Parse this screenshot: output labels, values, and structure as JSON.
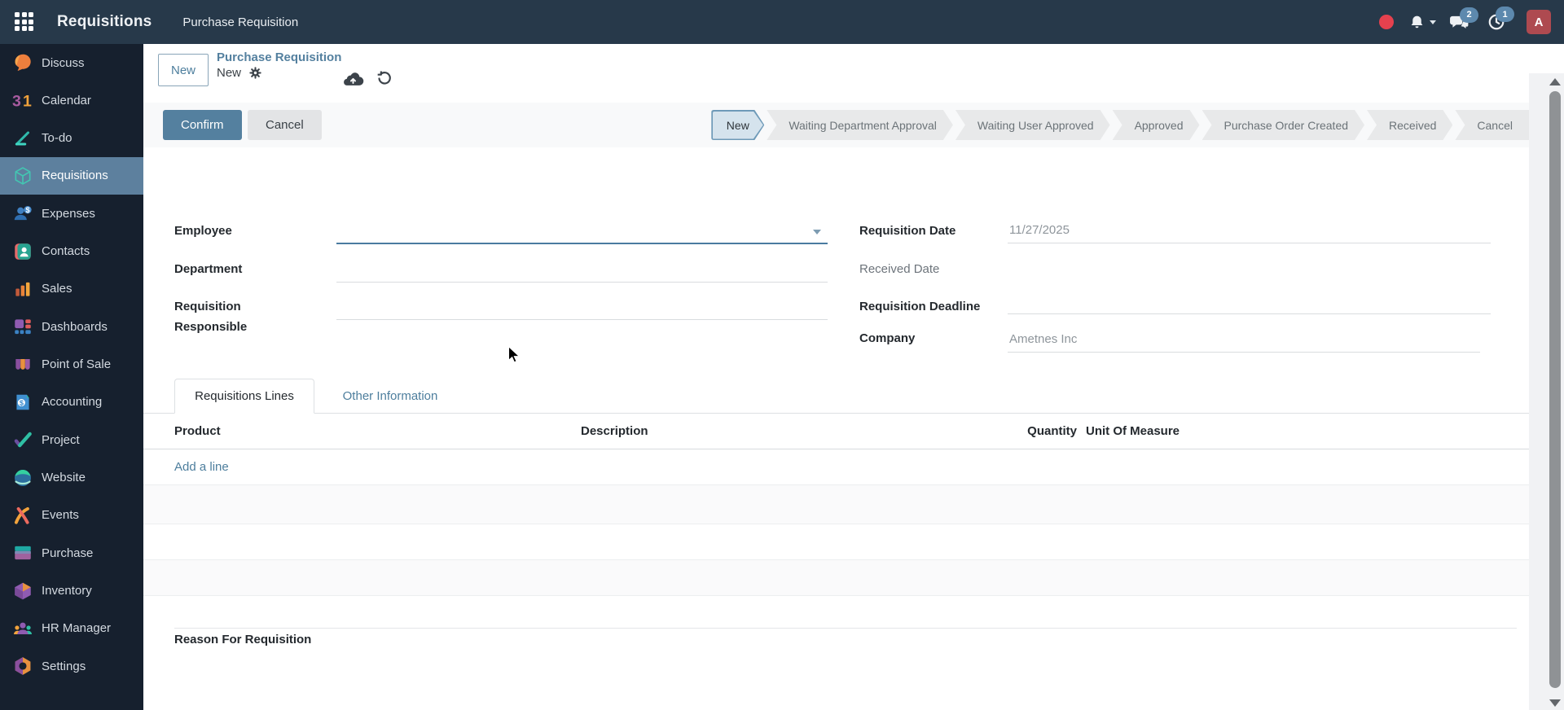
{
  "topbar": {
    "app_name": "Requisitions",
    "menu_item": "Purchase Requisition",
    "messages_badge": "2",
    "activities_badge": "1",
    "avatar_letter": "A"
  },
  "sidebar": {
    "items": [
      {
        "label": "Discuss",
        "icon": "discuss-icon",
        "active": false
      },
      {
        "label": "Calendar",
        "icon": "calendar-icon",
        "active": false
      },
      {
        "label": "To-do",
        "icon": "todo-icon",
        "active": false
      },
      {
        "label": "Requisitions",
        "icon": "requisitions-icon",
        "active": true
      },
      {
        "label": "Expenses",
        "icon": "expenses-icon",
        "active": false
      },
      {
        "label": "Contacts",
        "icon": "contacts-icon",
        "active": false
      },
      {
        "label": "Sales",
        "icon": "sales-icon",
        "active": false
      },
      {
        "label": "Dashboards",
        "icon": "dashboards-icon",
        "active": false
      },
      {
        "label": "Point of Sale",
        "icon": "point-of-sale-icon",
        "active": false
      },
      {
        "label": "Accounting",
        "icon": "accounting-icon",
        "active": false
      },
      {
        "label": "Project",
        "icon": "project-icon",
        "active": false
      },
      {
        "label": "Website",
        "icon": "website-icon",
        "active": false
      },
      {
        "label": "Events",
        "icon": "events-icon",
        "active": false
      },
      {
        "label": "Purchase",
        "icon": "purchase-icon",
        "active": false
      },
      {
        "label": "Inventory",
        "icon": "inventory-icon",
        "active": false
      },
      {
        "label": "HR Manager",
        "icon": "hr-manager-icon",
        "active": false
      },
      {
        "label": "Settings",
        "icon": "settings-icon",
        "active": false
      }
    ]
  },
  "breadcrumb": {
    "new_button": "New",
    "parent": "Purchase Requisition",
    "current": "New"
  },
  "actions": {
    "confirm": "Confirm",
    "cancel": "Cancel"
  },
  "statusbar": {
    "active": "New",
    "stages": [
      "New",
      "Waiting Department Approval",
      "Waiting User Approved",
      "Approved",
      "Purchase Order Created",
      "Received",
      "Cancel"
    ]
  },
  "form": {
    "fields": {
      "employee": {
        "label": "Employee",
        "value": ""
      },
      "department": {
        "label": "Department",
        "value": ""
      },
      "requisition_responsible": {
        "label": "Requisition Responsible",
        "value": ""
      },
      "requisition_date": {
        "label": "Requisition Date",
        "value": "11/27/2025"
      },
      "received_date": {
        "label": "Received Date",
        "value": ""
      },
      "requisition_deadline": {
        "label": "Requisition Deadline",
        "value": ""
      },
      "company": {
        "label": "Company",
        "value": "Ametnes Inc"
      }
    },
    "reason_label": "Reason For Requisition"
  },
  "tabs": [
    {
      "label": "Requisitions Lines",
      "active": true
    },
    {
      "label": "Other Information",
      "active": false
    }
  ],
  "lines_table": {
    "columns": [
      "Product",
      "Description",
      "Quantity",
      "Unit Of Measure"
    ],
    "add_line": "Add a line",
    "rows": []
  },
  "colors": {
    "navbar": "#27394a",
    "sidebar": "#16202e",
    "sidebar_active": "#5d809e",
    "accent": "#54809f",
    "link": "#4d7e9d",
    "confirm_bg": "#54809f",
    "cancel_bg": "#e3e4e6",
    "status_active_bg": "#d5e3ed",
    "status_active_border": "#6e9ab8",
    "status_bg": "#e8e9ea",
    "badge": "#5d89ae",
    "avatar_bg": "#ae4a50",
    "alert_dot": "#e5414e"
  }
}
